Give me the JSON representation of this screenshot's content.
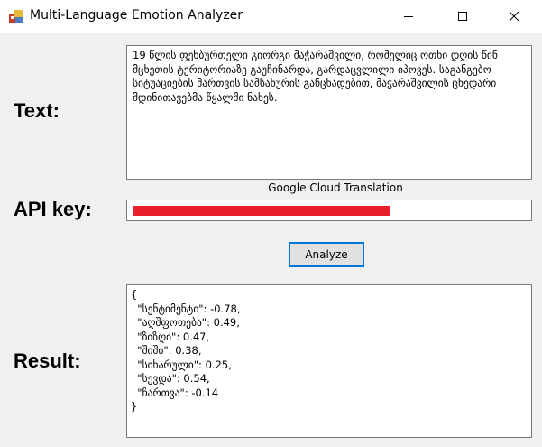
{
  "window": {
    "title": "Multi-Language Emotion Analyzer",
    "controls": [
      "minimize",
      "maximize",
      "close"
    ]
  },
  "form": {
    "text_label": "Text:",
    "text_value": "19 წლის ფეხბურთელი გიორგი მაჭარაშვილი, რომელიც ოთხი დღის წინ მცხეთის ტერიტორიაზე გაუჩინარდა, გარდაცვლილი იპოვეს. საგანგებო სიტუაციების მართვის სამსახურის განცხადებით, მაჭარაშვილის ცხედარი მდინითავებმა წყალში ნახეს.",
    "api_label": "API key:",
    "api_provider": "Google Cloud Translation",
    "api_value_redacted": true,
    "analyze_button": "Analyze",
    "result_label": "Result:"
  },
  "result": {
    "lines": [
      "{",
      "  \"სენტიმენტი\": -0.78,",
      "  \"აღშფოთება\": 0.49,",
      "  \"ზიზღი\": 0.47,",
      "  \"შიში\": 0.38,",
      "  \"სიხარული\": 0.25,",
      "  \"სევდა\": 0.54,",
      "  \"ჩართვა\": -0.14",
      "}"
    ]
  },
  "colors": {
    "focus_border": "#0078d7",
    "redaction": "#e8202c",
    "form_background": "#f0f0f0"
  }
}
